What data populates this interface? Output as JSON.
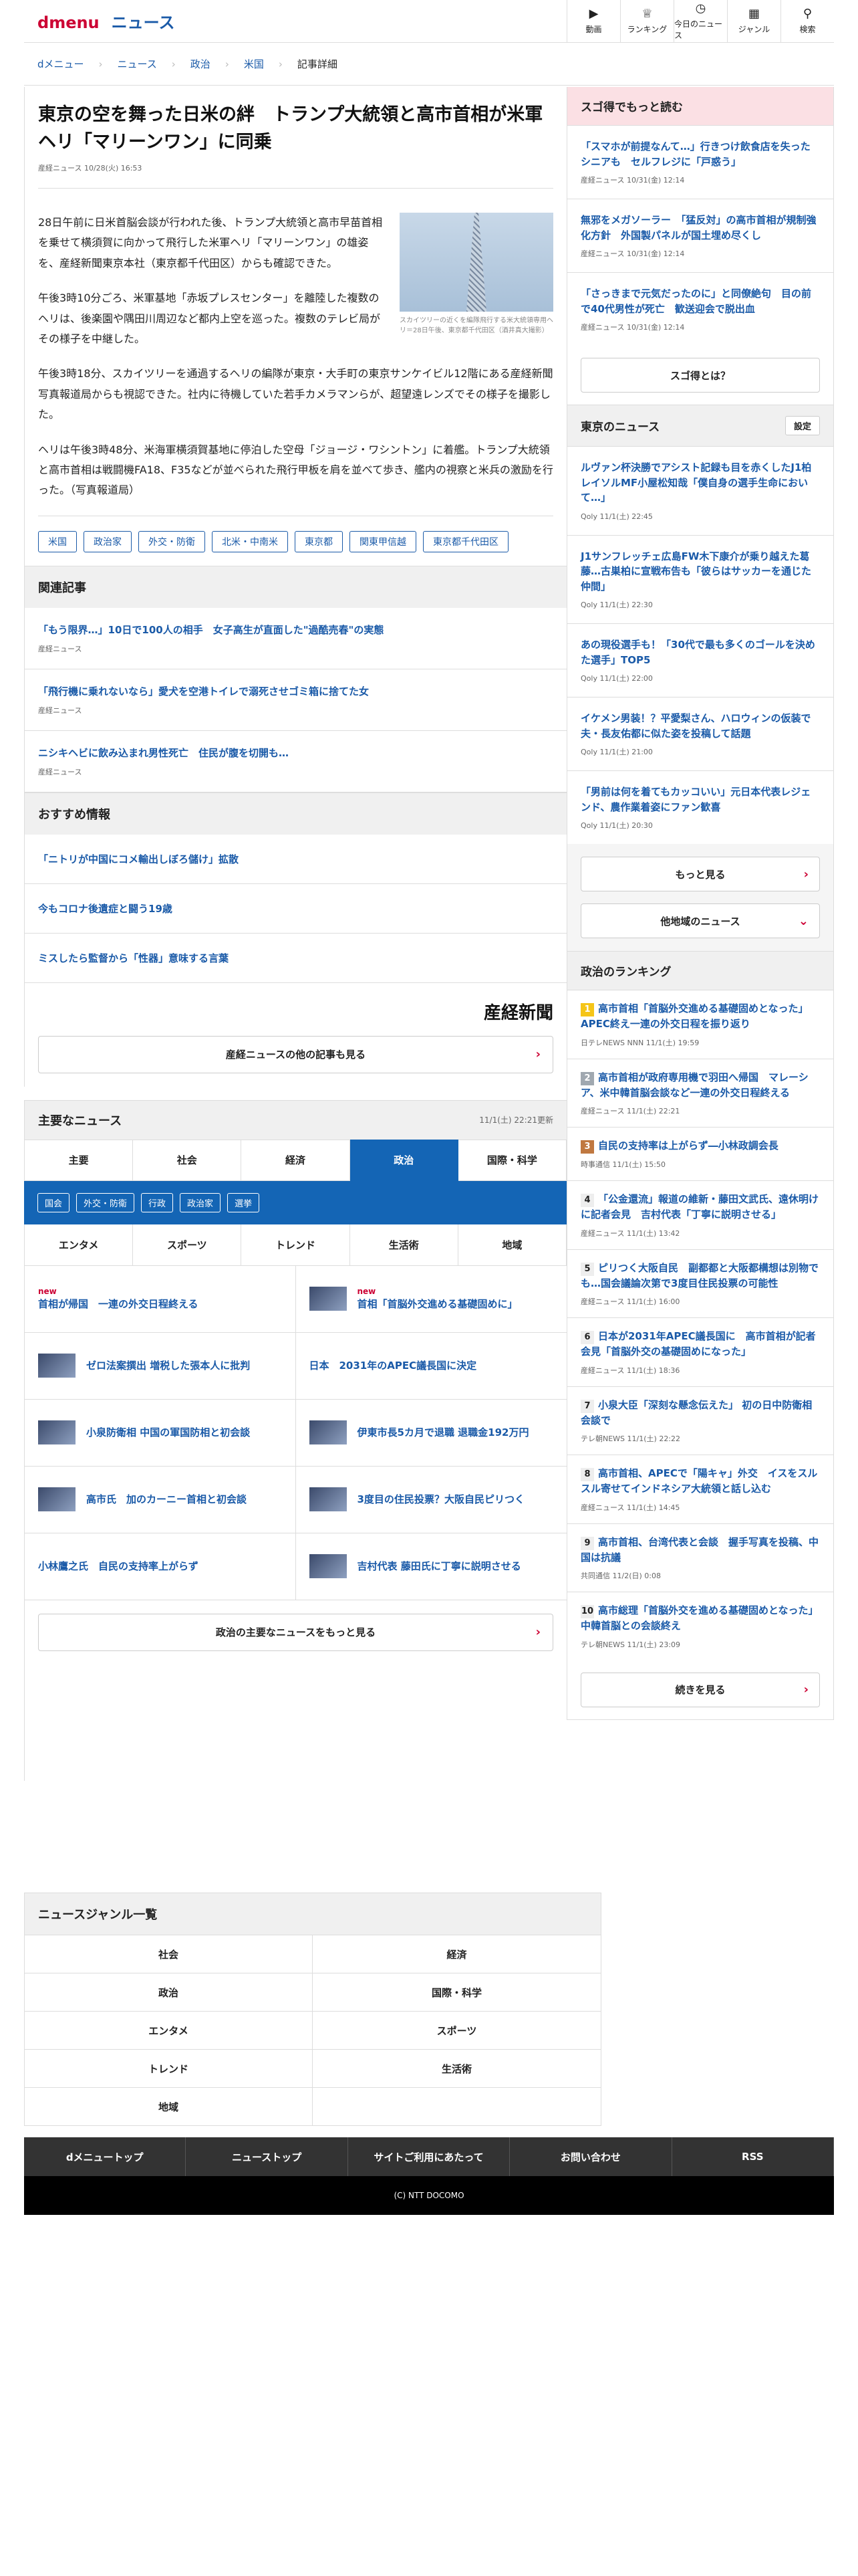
{
  "header": {
    "logo_d": "d",
    "logo_menu": "menu",
    "logo_news": "ニュース",
    "nav": [
      {
        "label": "動画",
        "icon": "video-icon"
      },
      {
        "label": "ランキング",
        "icon": "trophy-icon"
      },
      {
        "label": "今日のニュース",
        "icon": "clock-icon"
      },
      {
        "label": "ジャンル",
        "icon": "grid-icon"
      },
      {
        "label": "検索",
        "icon": "search-icon"
      }
    ]
  },
  "breadcrumb": [
    "dメニュー",
    "ニュース",
    "政治",
    "米国",
    "記事詳細"
  ],
  "article": {
    "title": "東京の空を舞った日米の絆　トランプ大統領と高市首相が米軍ヘリ「マリーンワン」に同乗",
    "meta": "産経ニュース 10/28(火) 16:53",
    "photo_caption": "スカイツリーの近くを編隊飛行する米大統領専用ヘリ＝28日午後、東京都千代田区（酒井真大撮影）",
    "paragraphs": [
      "28日午前に日米首脳会談が行われた後、トランプ大統領と高市早苗首相を乗せて横須賀に向かって飛行した米軍ヘリ「マリーンワン」の雄姿を、産経新聞東京本社（東京都千代田区）からも確認できた。",
      "午後3時10分ごろ、米軍基地「赤坂プレスセンター」を離陸した複数のヘリは、後楽園や隅田川周辺など都内上空を巡った。複数のテレビ局がその様子を中継した。",
      "午後3時18分、スカイツリーを通過するヘリの編隊が東京・大手町の東京サンケイビル12階にある産経新聞写真報道局からも視認できた。社内に待機していた若手カメラマンらが、超望遠レンズでその様子を撮影した。",
      "ヘリは午後3時48分、米海軍横須賀基地に停泊した空母「ジョージ・ワシントン」に着艦。トランプ大統領と高市首相は戦闘機FA18、F35などが並べられた飛行甲板を肩を並べて歩き、艦内の視察と米兵の激励を行った。（写真報道局）"
    ],
    "tags": [
      "米国",
      "政治家",
      "外交・防衛",
      "北米・中南米",
      "東京都",
      "関東甲信越",
      "東京都千代田区"
    ]
  },
  "related": {
    "title": "関連記事",
    "items": [
      {
        "title": "「もう限界…」10日で100人の相手　女子高生が直面した\"過酷売春\"の実態",
        "source": "産経ニュース"
      },
      {
        "title": "「飛行機に乗れないなら」愛犬を空港トイレで溺死させゴミ箱に捨てた女",
        "source": "産経ニュース"
      },
      {
        "title": "ニシキヘビに飲み込まれ男性死亡　住民が腹を切開も…",
        "source": "産経ニュース"
      }
    ]
  },
  "recommend": {
    "title": "おすすめ情報",
    "items": [
      "「ニトリが中国にコメ輸出しぼろ儲け」拡散",
      "今もコロナ後遺症と闘う19歳",
      "ミスしたら監督から「性器」意味する言葉"
    ]
  },
  "sankei": {
    "logo": "産経新聞",
    "more": "産経ニュースの他の記事も見る"
  },
  "major": {
    "title": "主要なニュース",
    "updated": "11/1(土) 22:21更新",
    "tabs1": [
      "主要",
      "社会",
      "経済",
      "政治",
      "国際・科学"
    ],
    "subtabs": [
      "国会",
      "外交・防衛",
      "行政",
      "政治家",
      "選挙"
    ],
    "tabs2": [
      "エンタメ",
      "スポーツ",
      "トレンド",
      "生活術",
      "地域"
    ],
    "news": [
      {
        "title": "首相が帰国　一連の外交日程終える",
        "new": "new",
        "thumb": false
      },
      {
        "title": "首相「首脳外交進める基礎固めに」",
        "new": "new",
        "thumb": true
      },
      {
        "title": "ゼロ法案撰出 増税した張本人に批判",
        "new": "",
        "thumb": true
      },
      {
        "title": "日本　2031年のAPEC議長国に決定",
        "new": "",
        "thumb": false
      },
      {
        "title": "小泉防衛相 中国の軍国防相と初会談",
        "new": "",
        "thumb": true
      },
      {
        "title": "伊東市長5カ月で退職 退職金192万円",
        "new": "",
        "thumb": true
      },
      {
        "title": "高市氏　加のカーニー首相と初会談",
        "new": "",
        "thumb": true
      },
      {
        "title": "3度目の住民投票？大阪自民ピリつく",
        "new": "",
        "thumb": true
      },
      {
        "title": "小林鷹之氏　自民の支持率上がらず",
        "new": "",
        "thumb": false
      },
      {
        "title": "吉村代表 藤田氏に丁寧に説明させる",
        "new": "",
        "thumb": true
      }
    ],
    "more": "政治の主要なニュースをもっと見る"
  },
  "sidebar": {
    "sugotoku": {
      "title": "スゴ得でもっと読む",
      "items": [
        {
          "title": "「スマホが前提なんて…」行きつけ飲食店を失ったシニアも　セルフレジに「戸惑う」",
          "source": "産経ニュース 10/31(金) 12:14"
        },
        {
          "title": "無邪をメガソーラー　「猛反対」の高市首相が規制強化方針　外国製パネルが国土埋め尽くし",
          "source": "産経ニュース 10/31(金) 12:14"
        },
        {
          "title": "「さっきまで元気だったのに」と同僚絶句　目の前で40代男性が死亡　歓送迎会で脱出血",
          "source": "産経ニュース 10/31(金) 12:14"
        }
      ],
      "button": "スゴ得とは？"
    },
    "tokyo": {
      "title": "東京のニュース",
      "settings": "設定",
      "items": [
        {
          "title": "ルヴァン杯決勝でアシスト記録も目を赤くしたJ1柏レイソルMF小屋松知哉「僕自身の選手生命において…」",
          "source": "Qoly 11/1(土) 22:45"
        },
        {
          "title": "J1サンフレッチェ広島FW木下康介が乗り越えた葛藤…古巣柏に宣戦布告も「彼らはサッカーを通じた仲間」",
          "source": "Qoly 11/1(土) 22:30"
        },
        {
          "title": "あの現役選手も！「30代で最も多くのゴールを決めた選手」TOP5",
          "source": "Qoly 11/1(土) 22:00"
        },
        {
          "title": "イケメン男装！？平愛梨さん、ハロウィンの仮装で夫・長友佑都に似た姿を投稿して話題",
          "source": "Qoly 11/1(土) 21:00"
        },
        {
          "title": "「男前は何を着てもカッコいい」元日本代表レジェンド、農作業着姿にファン歓喜",
          "source": "Qoly 11/1(土) 20:30"
        }
      ],
      "more": "もっと見る",
      "other": "他地域のニュース"
    },
    "ranking": {
      "title": "政治のランキング",
      "items": [
        {
          "rank": "1",
          "title": "高市首相「首脳外交進める基礎固めとなった」APEC終え一連の外交日程を振り返り",
          "source": "日テレNEWS NNN 11/1(土) 19:59"
        },
        {
          "rank": "2",
          "title": "高市首相が政府専用機で羽田へ帰国　マレーシア、米中韓首脳会談など一連の外交日程終える",
          "source": "産経ニュース 11/1(土) 22:21"
        },
        {
          "rank": "3",
          "title": "自民の支持率は上がらず―小林政調会長",
          "source": "時事通信 11/1(土) 15:50"
        },
        {
          "rank": "4",
          "title": "「公金還流」報道の維新・藤田文武氏、遠休明けに記者会見　吉村代表「丁寧に説明させる」",
          "source": "産経ニュース 11/1(土) 13:42"
        },
        {
          "rank": "5",
          "title": "ピリつく大阪自民　副都都と大阪都構想は別物でも…国会議論次第で3度目住民投票の可能性",
          "source": "産経ニュース 11/1(土) 16:00"
        },
        {
          "rank": "6",
          "title": "日本が2031年APEC議長国に　高市首相が記者会見「首脳外交の基礎固めになった」",
          "source": "産経ニュース 11/1(土) 18:36"
        },
        {
          "rank": "7",
          "title": "小泉大臣「深刻な懸念伝えた」 初の日中防衛相会談で",
          "source": "テレ朝NEWS 11/1(土) 22:22"
        },
        {
          "rank": "8",
          "title": "高市首相、APECで「陽キャ」外交　イスをスルスル寄せてインドネシア大統領と話し込む",
          "source": "産経ニュース 11/1(土) 14:45"
        },
        {
          "rank": "9",
          "title": "高市首相、台湾代表と会談　握手写真を投稿、中国は抗議",
          "source": "共同通信 11/2(日) 0:08"
        },
        {
          "rank": "10",
          "title": "高市総理「首脳外交を進める基礎固めとなった」 中韓首脳との会談終え",
          "source": "テレ朝NEWS 11/1(土) 23:09"
        }
      ],
      "more": "続きを見る"
    }
  },
  "genres": {
    "title": "ニュースジャンル一覧",
    "items": [
      "社会",
      "経済",
      "政治",
      "国際・科学",
      "エンタメ",
      "スポーツ",
      "トレンド",
      "生活術",
      "地域"
    ]
  },
  "footer": {
    "links": [
      "dメニュートップ",
      "ニューストップ",
      "サイトご利用にあたって",
      "お問い合わせ",
      "RSS"
    ],
    "copyright": "(C) NTT DOCOMO"
  }
}
